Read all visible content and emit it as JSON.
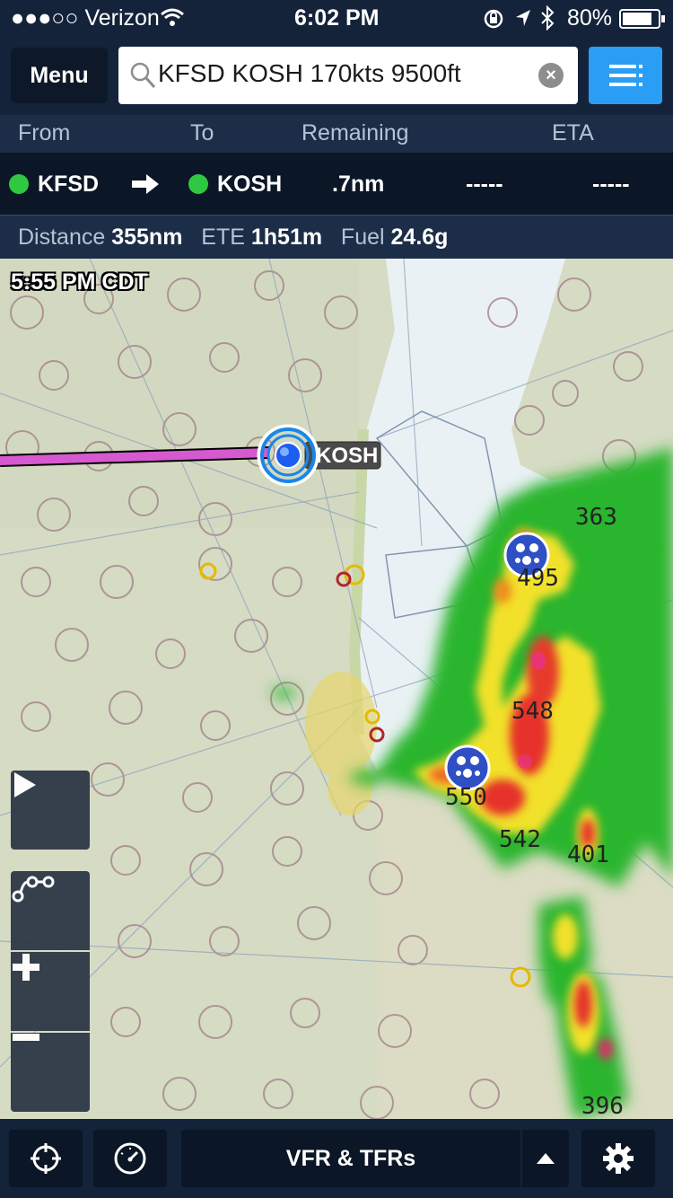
{
  "status_bar": {
    "carrier": "●●●○○ Verizon",
    "time": "6:02 PM",
    "battery": "80%"
  },
  "toolbar": {
    "menu_label": "Menu",
    "search_value": "KFSD KOSH 170kts 9500ft"
  },
  "route_header": {
    "from": "From",
    "to": "To",
    "remaining": "Remaining",
    "eta": "ETA"
  },
  "route": {
    "from": "KFSD",
    "to": "KOSH",
    "remaining": ".7nm",
    "col4": "-----",
    "col5": "-----"
  },
  "summary": {
    "distance_label": "Distance",
    "distance": "355nm",
    "ete_label": "ETE",
    "ete": "1h51m",
    "fuel_label": "Fuel",
    "fuel": "24.6g"
  },
  "map": {
    "timestamp": "5:55 PM CDT",
    "destination_label": "KOSH",
    "storm_tops": [
      "363",
      "495",
      "548",
      "550",
      "542",
      "401",
      "396"
    ]
  },
  "bottom_bar": {
    "layer_label": "VFR & TFRs"
  },
  "colors": {
    "accent": "#2a9df4",
    "route": "#d659d0",
    "status_ok": "#2ec940"
  }
}
